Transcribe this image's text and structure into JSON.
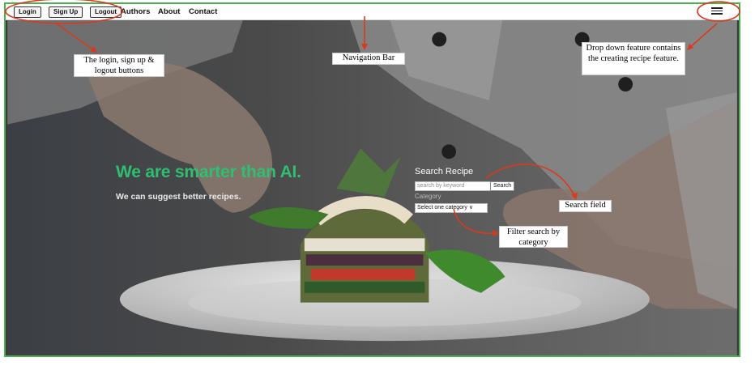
{
  "navbar": {
    "login_label": "Login",
    "signup_label": "Sign Up",
    "logout_label": "Logout",
    "links": [
      "Authors",
      "About",
      "Contact"
    ]
  },
  "hero": {
    "title": "We are smarter than AI.",
    "subtitle": "We can suggest better recipes."
  },
  "search": {
    "title": "Search Recipe",
    "placeholder": "search by keyword",
    "button_label": "Search",
    "category_label": "Category",
    "category_selected": "Select one category ∨"
  },
  "annotations": {
    "auth_buttons": "The login, sign up & logout buttons",
    "navbar": "Navigation Bar",
    "dropdown": "Drop down feature contains the creating recipe feature.",
    "search_field": "Search field",
    "filter": "Filter search by category"
  },
  "colors": {
    "accent_green": "#2fbf71",
    "annotation_red": "#d93a1f",
    "frame_green": "#4caf50"
  },
  "icons": [
    "hamburger-menu-icon"
  ]
}
